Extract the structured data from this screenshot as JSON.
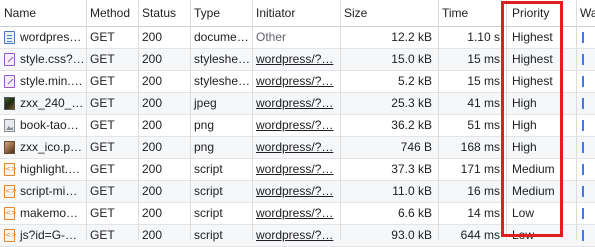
{
  "headers": {
    "name": "Name",
    "method": "Method",
    "status": "Status",
    "type": "Type",
    "initiator": "Initiator",
    "size": "Size",
    "time": "Time",
    "priority": "Priority",
    "waterfall": "Wa"
  },
  "rows": [
    {
      "name": "wordpres…",
      "icon": "document-icon",
      "method": "GET",
      "status": "200",
      "type": "docume…",
      "initiator": "Other",
      "size": "12.2 kB",
      "time": "1.10 s",
      "priority": "Highest"
    },
    {
      "name": "style.css?…",
      "icon": "stylesheet-icon",
      "method": "GET",
      "status": "200",
      "type": "styleshe…",
      "initiator": "wordpress/?…",
      "size": "15.0 kB",
      "time": "15 ms",
      "priority": "Highest"
    },
    {
      "name": "style.min.…",
      "icon": "stylesheet-icon",
      "method": "GET",
      "status": "200",
      "type": "styleshe…",
      "initiator": "wordpress/?…",
      "size": "5.2 kB",
      "time": "15 ms",
      "priority": "Highest"
    },
    {
      "name": "zxx_240_…",
      "icon": "image-thumbnail-icon",
      "method": "GET",
      "status": "200",
      "type": "jpeg",
      "initiator": "wordpress/?…",
      "size": "25.3 kB",
      "time": "41 ms",
      "priority": "High"
    },
    {
      "name": "book-tao…",
      "icon": "image-placeholder-icon",
      "method": "GET",
      "status": "200",
      "type": "png",
      "initiator": "wordpress/?…",
      "size": "36.2 kB",
      "time": "51 ms",
      "priority": "High"
    },
    {
      "name": "zxx_ico.p…",
      "icon": "image-thumbnail-icon",
      "method": "GET",
      "status": "200",
      "type": "png",
      "initiator": "wordpress/?…",
      "size": "746 B",
      "time": "168 ms",
      "priority": "High"
    },
    {
      "name": "highlight.…",
      "icon": "script-icon",
      "method": "GET",
      "status": "200",
      "type": "script",
      "initiator": "wordpress/?…",
      "size": "37.3 kB",
      "time": "171 ms",
      "priority": "Medium"
    },
    {
      "name": "script-mi…",
      "icon": "script-icon",
      "method": "GET",
      "status": "200",
      "type": "script",
      "initiator": "wordpress/?…",
      "size": "11.0 kB",
      "time": "16 ms",
      "priority": "Medium"
    },
    {
      "name": "makemo…",
      "icon": "script-icon",
      "method": "GET",
      "status": "200",
      "type": "script",
      "initiator": "wordpress/?…",
      "size": "6.6 kB",
      "time": "14 ms",
      "priority": "Low"
    },
    {
      "name": "js?id=G-…",
      "icon": "script-icon",
      "method": "GET",
      "status": "200",
      "type": "script",
      "initiator": "wordpress/?…",
      "size": "93.0 kB",
      "time": "644 ms",
      "priority": "Low"
    }
  ],
  "colors": {
    "highlight_box": "#e01e1e",
    "waterfall_bar": "#3b7ce6",
    "alt_row": "#f6f7f8"
  }
}
